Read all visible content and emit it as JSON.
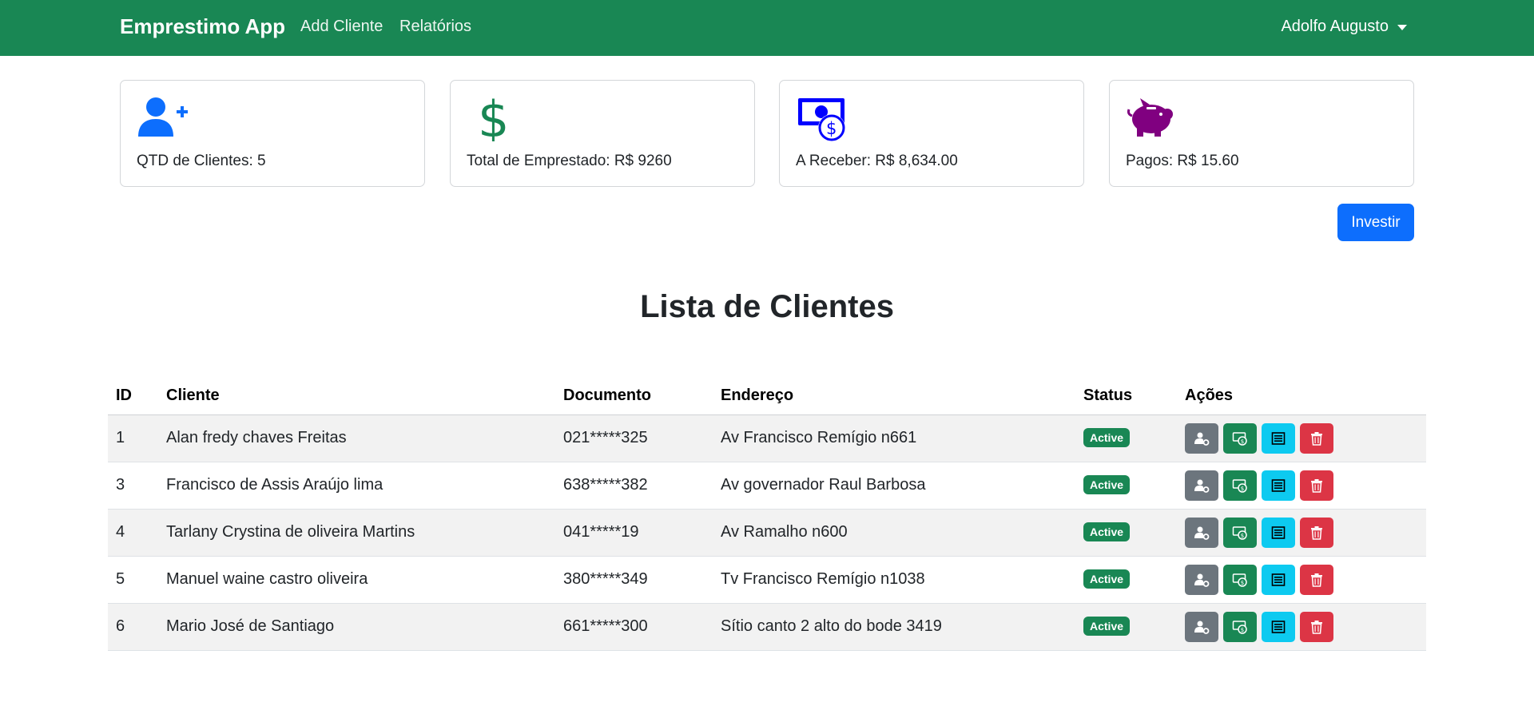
{
  "navbar": {
    "brand": "Emprestimo App",
    "links": [
      "Add Cliente",
      "Relatórios"
    ],
    "user": "Adolfo Augusto"
  },
  "cards": [
    {
      "icon": "user-plus-icon",
      "label": "QTD de Clientes: 5",
      "color": "#0d6efd"
    },
    {
      "icon": "dollar-icon",
      "label": "Total de Emprestado: R$ 9260",
      "color": "#198754"
    },
    {
      "icon": "cash-coin-icon",
      "label": "A Receber: R$ 8,634.00",
      "color": "#0000ff"
    },
    {
      "icon": "piggy-bank-icon",
      "label": "Pagos: R$ 15.60",
      "color": "#800080"
    }
  ],
  "invest_button": "Investir",
  "title": "Lista de Clientes",
  "table": {
    "headers": [
      "ID",
      "Cliente",
      "Documento",
      "Endereço",
      "Status",
      "Ações"
    ],
    "rows": [
      {
        "id": "1",
        "cliente": "Alan fredy chaves Freitas",
        "documento": "021*****325",
        "endereco": "Av Francisco Remígio n661",
        "status": "Active"
      },
      {
        "id": "3",
        "cliente": "Francisco de Assis Araújo lima",
        "documento": "638*****382",
        "endereco": "Av governador Raul Barbosa",
        "status": "Active"
      },
      {
        "id": "4",
        "cliente": "Tarlany Crystina de oliveira Martins",
        "documento": "041*****19",
        "endereco": "Av Ramalho n600",
        "status": "Active"
      },
      {
        "id": "5",
        "cliente": "Manuel waine castro oliveira",
        "documento": "380*****349",
        "endereco": "Tv Francisco Remígio n1038",
        "status": "Active"
      },
      {
        "id": "6",
        "cliente": "Mario José de Santiago",
        "documento": "661*****300",
        "endereco": "Sítio canto 2 alto do bode 3419",
        "status": "Active"
      }
    ],
    "action_icons": [
      "user-gear-icon",
      "cash-icon",
      "list-icon",
      "trash-icon"
    ]
  }
}
